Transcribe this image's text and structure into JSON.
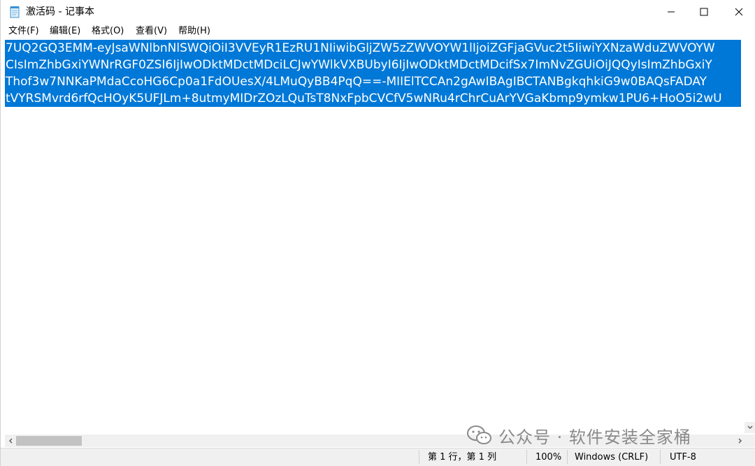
{
  "window": {
    "title": "激活码 - 记事本"
  },
  "menu": [
    "文件(F)",
    "编辑(E)",
    "格式(O)",
    "查看(V)",
    "帮助(H)"
  ],
  "editor": {
    "lines": [
      "7UQ2GQ3EMM-eyJsaWNlbnNlSWQiOiI3VVEyR1EzRU1NIiwibGljZW5zZWVOYW1lIjoiZGFjaGVuc2t5IiwiYXNzaWduZWVOYW",
      "CIsImZhbGxiYWNrRGF0ZSI6IjIwODktMDctMDciLCJwYWlkVXBUbyI6IjIwODktMDctMDcifSx7ImNvZGUiOiJQQyIsImZhbGxiY",
      "Thof3w7NNKaPMdaCcoHG6Cp0a1FdOUesX/4LMuQyBB4PqQ==-MIIElTCCAn2gAwIBAgIBCTANBgkqhkiG9w0BAQsFADAY",
      "tVYRSMvrd6rfQcHOyK5UFJLm+8utmyMIDrZOzLQuTsT8NxFpbCVCfV5wNRu4rChrCuArYVGaKbmp9ymkw1PU6+HoO5i2wU"
    ]
  },
  "status": {
    "position": "第 1 行，第 1 列",
    "zoom": "100%",
    "line_ending": "Windows (CRLF)",
    "encoding": "UTF-8"
  },
  "watermark": {
    "text": "公众号 · 软件安装全家桶"
  },
  "colors": {
    "selection": "#0078d7",
    "statusbar": "#f0f0f0"
  }
}
